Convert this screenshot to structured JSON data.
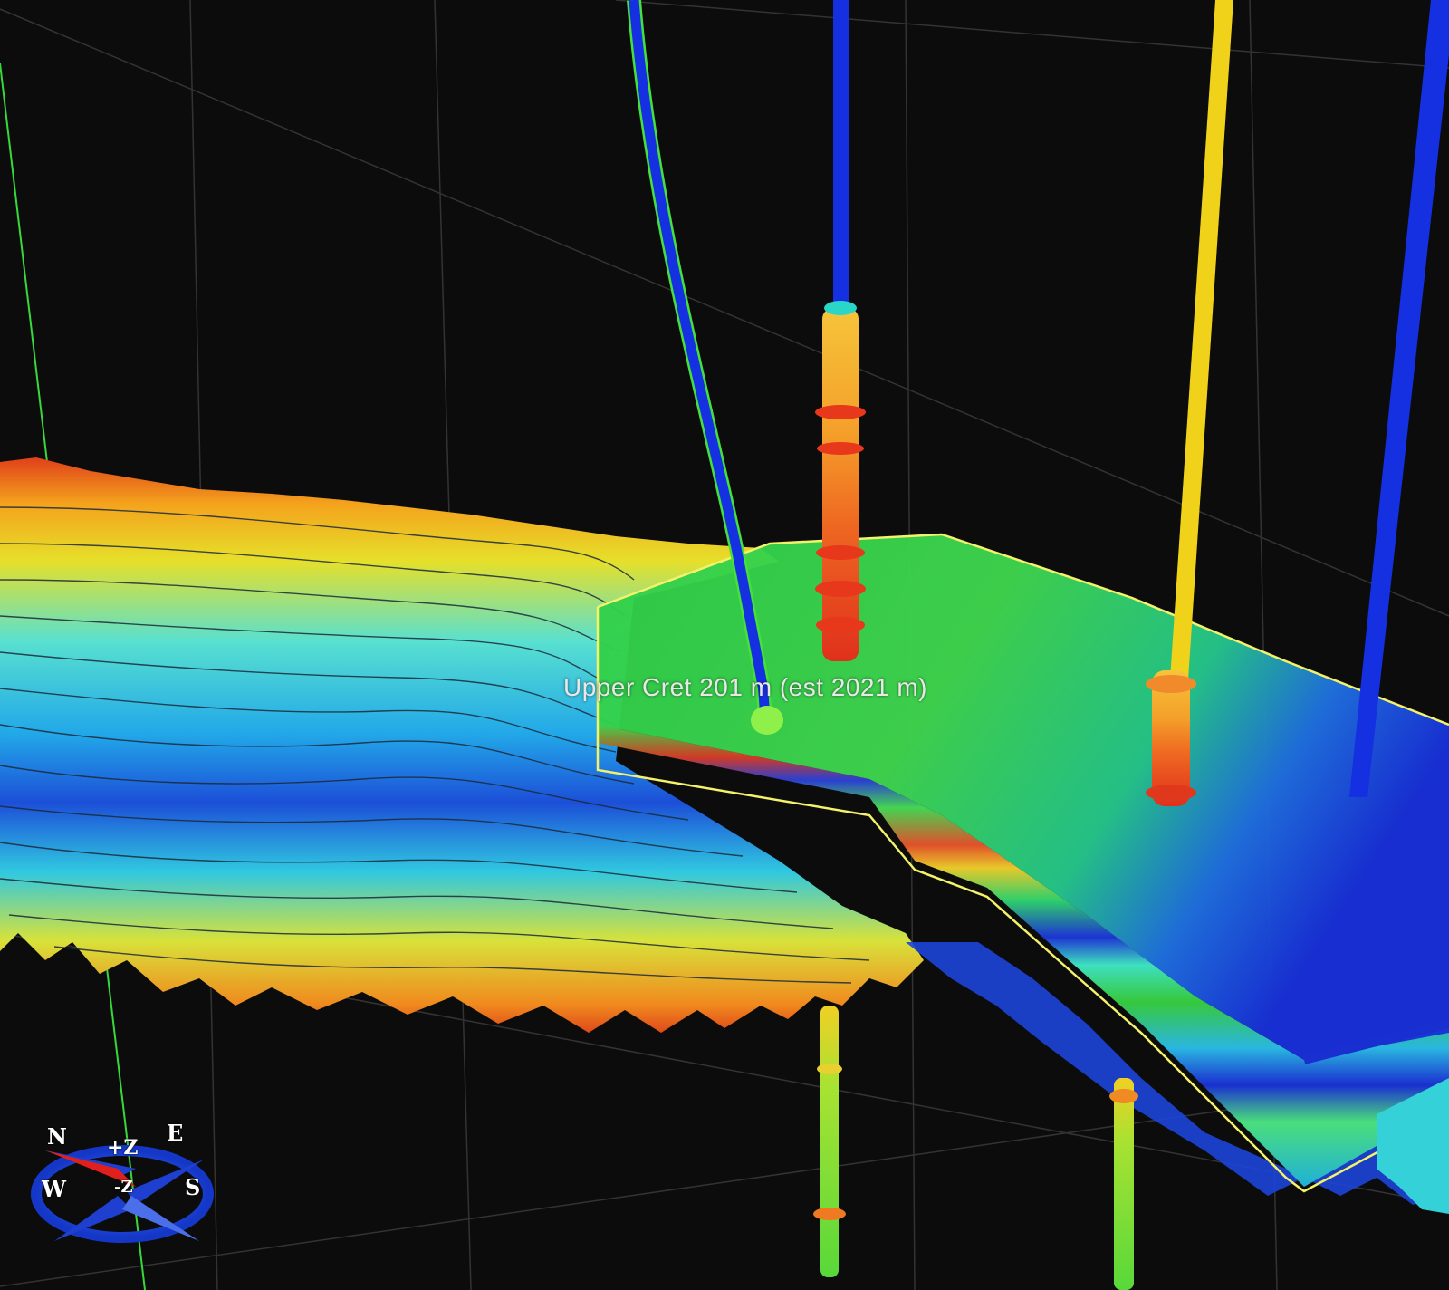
{
  "viewport": {
    "horizon_label": "Upper Cret 201 m (est 2021 m)"
  },
  "compass": {
    "north": "N",
    "east": "E",
    "south": "S",
    "west": "W",
    "up": "+Z",
    "down": "-Z"
  },
  "colors": {
    "background": "#0c0c0c",
    "grid": "#3a3a3a",
    "well_blue": "#1530e0",
    "well_yellow": "#f0d21a",
    "grid_outline": "#f4f26a",
    "compass_ring": "#1f4fd8",
    "compass_arrow": "#e0201c"
  },
  "color_scale": [
    "#1c2fd6",
    "#1f8be6",
    "#33d4e0",
    "#3ee27a",
    "#c8e33a",
    "#f4d21c",
    "#f08a1e",
    "#e0381a"
  ]
}
